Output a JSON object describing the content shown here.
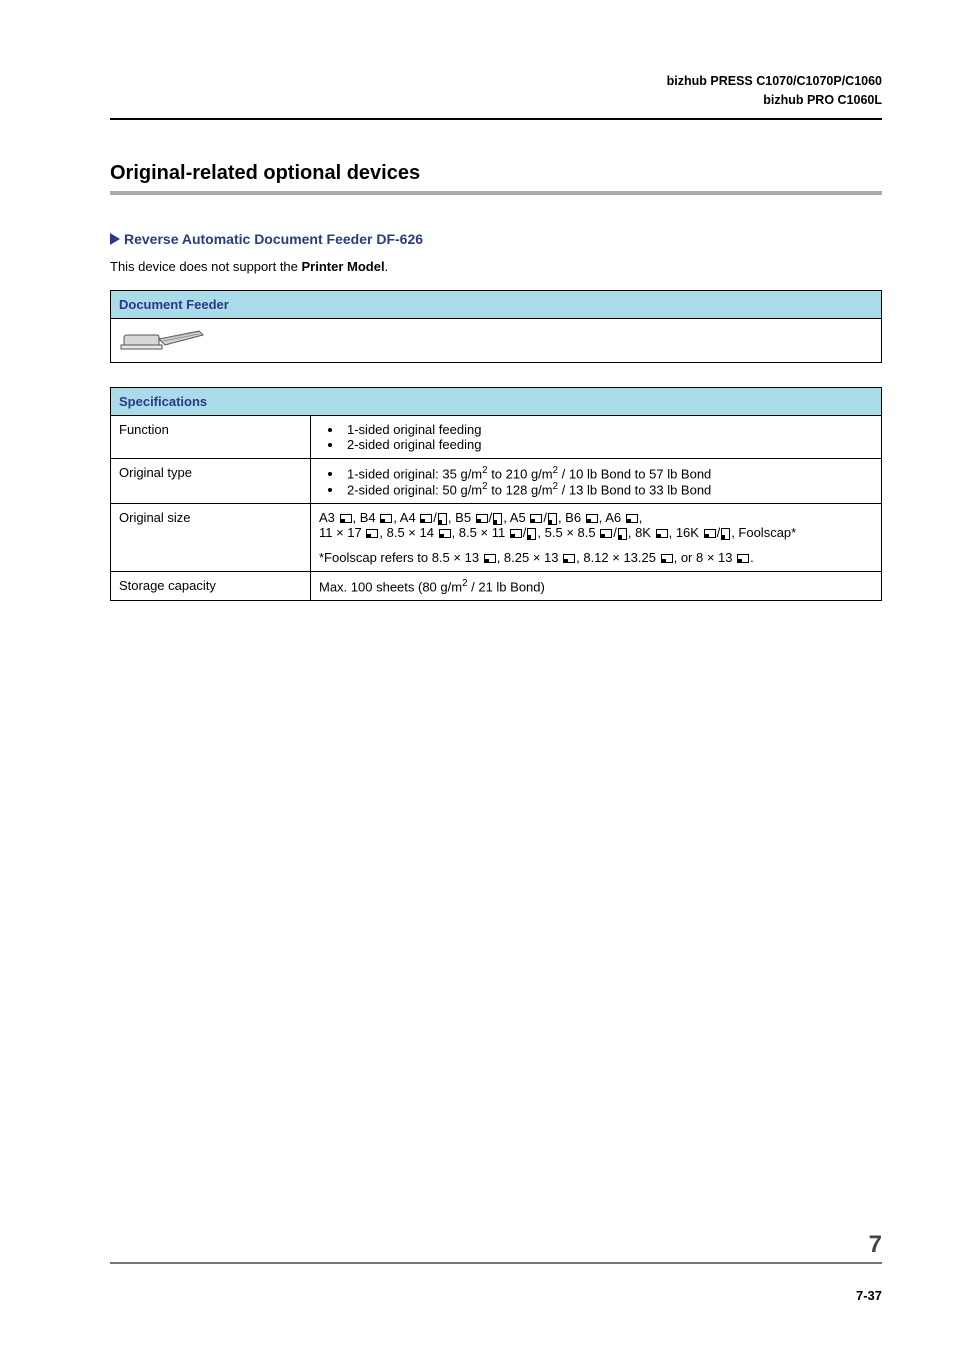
{
  "header": {
    "line1": "bizhub PRESS C1070/C1070P/C1060",
    "line2": "bizhub PRO C1060L"
  },
  "section_title": "Original-related optional devices",
  "sub_heading": "Reverse Automatic Document Feeder DF-626",
  "body_text_prefix": "This device does not support the ",
  "body_text_bold": "Printer Model",
  "body_text_suffix": ".",
  "table1": {
    "header": "Document Feeder"
  },
  "table2": {
    "header": "Specifications",
    "rows": {
      "function": {
        "label": "Function",
        "items": [
          "1-sided original feeding",
          "2-sided original feeding"
        ]
      },
      "original_type": {
        "label": "Original type",
        "item1_a": "1-sided original: 35 g/m",
        "item1_b": " to 210 g/m",
        "item1_c": " / 10 lb Bond to 57 lb Bond",
        "item2_a": "2-sided original: 50 g/m",
        "item2_b": " to 128 g/m",
        "item2_c": " / 13 lb Bond to 33 lb Bond"
      },
      "original_size": {
        "label": "Original size",
        "line1_parts": [
          "A3 ",
          ", B4 ",
          ", A4 ",
          "/",
          ", B5 ",
          "/",
          ", A5 ",
          "/",
          ", B6 ",
          ", A6 ",
          ","
        ],
        "line2_parts": [
          "11 × 17 ",
          ", 8.5 × 14 ",
          ", 8.5 × 11 ",
          "/",
          ", 5.5 × 8.5 ",
          "/",
          ", 8K ",
          ", 16K ",
          "/",
          ", Foolscap*"
        ],
        "line3_parts": [
          "*Foolscap refers to 8.5 × 13 ",
          ", 8.25 × 13 ",
          ", 8.12 × 13.25 ",
          ", or 8 × 13 ",
          "."
        ]
      },
      "storage": {
        "label": "Storage capacity",
        "value_a": "Max. 100 sheets (80 g/m",
        "value_b": " / 21 lb Bond)"
      }
    }
  },
  "footer": {
    "chapter": "7",
    "page": "7-37"
  },
  "chart_data": null
}
